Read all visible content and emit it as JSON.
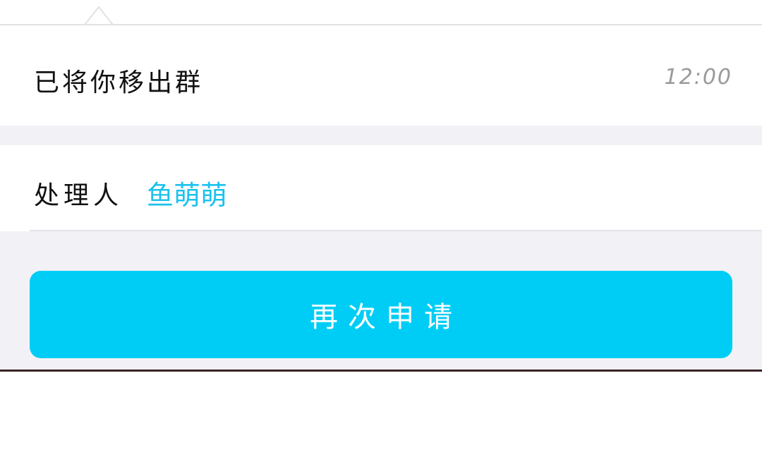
{
  "message": {
    "text": "已将你移出群",
    "time": "12:00"
  },
  "handler": {
    "label": "处理人",
    "name": "鱼萌萌"
  },
  "action": {
    "reapply_label": "再次申请"
  },
  "colors": {
    "accent": "#00cdf5",
    "link": "#1cc2ee",
    "background_gray": "#f2f2f6"
  }
}
